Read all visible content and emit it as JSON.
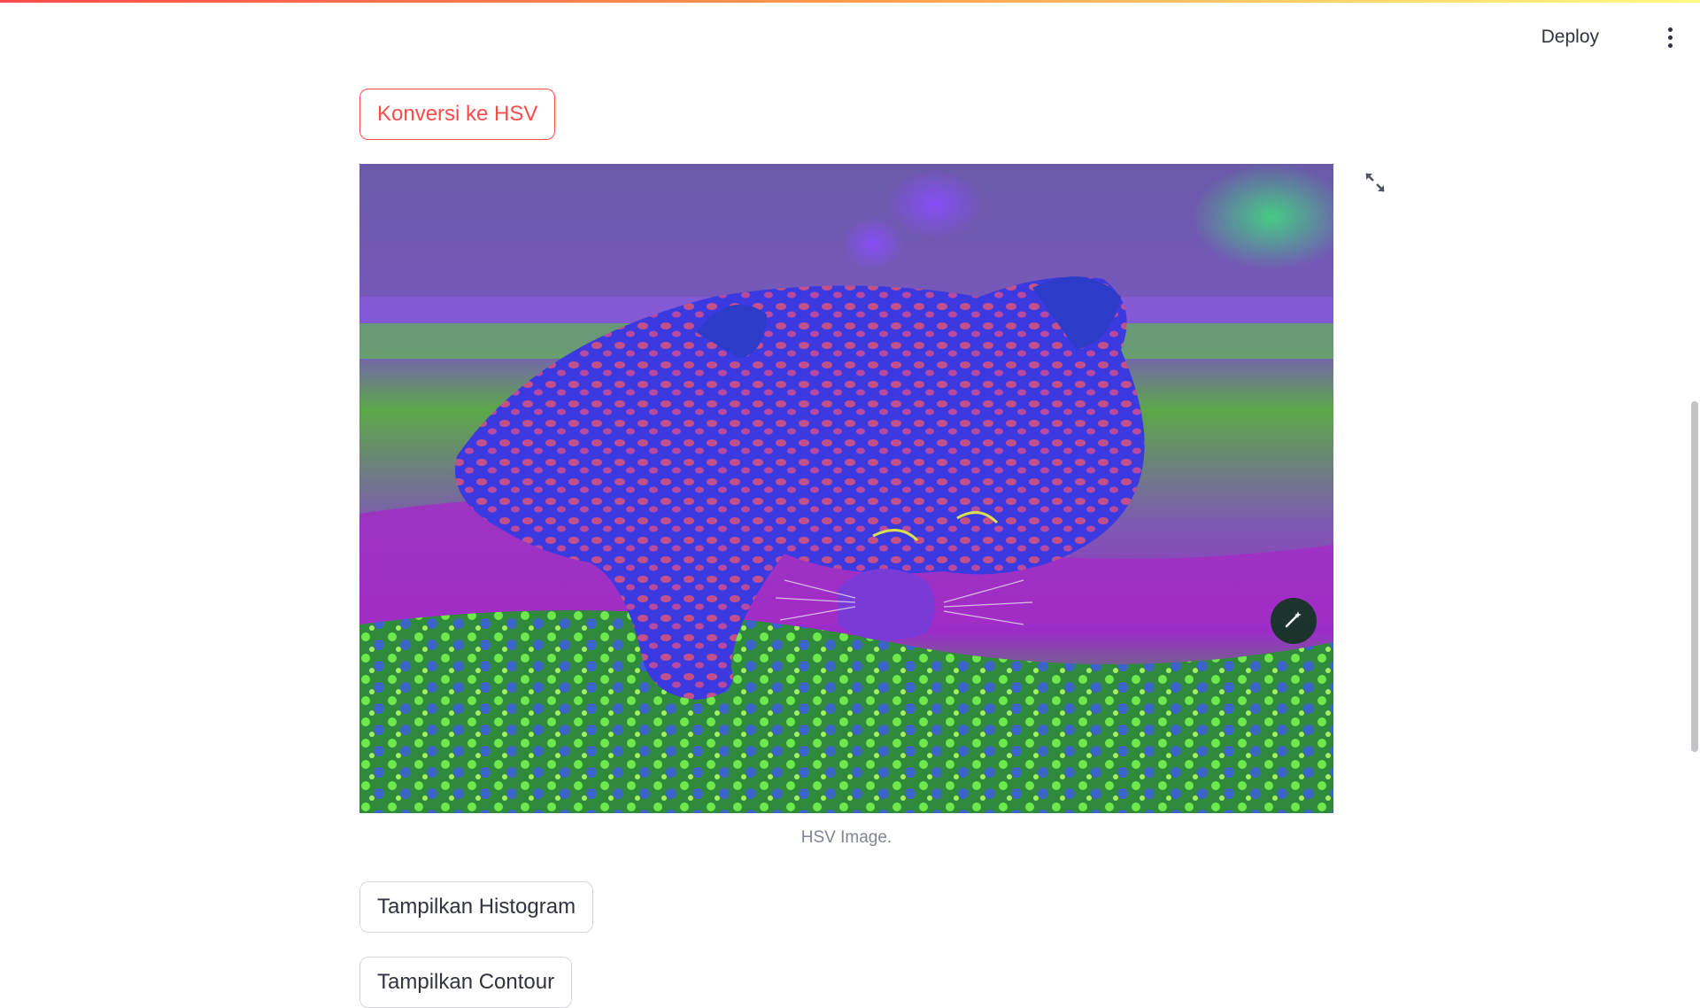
{
  "header": {
    "deploy_label": "Deploy",
    "menu_icon": "vertical-ellipsis-icon"
  },
  "main": {
    "convert_button_label": "Konversi ke HSV",
    "image": {
      "alt": "HSV converted leopard image",
      "caption": "HSV Image.",
      "expand_icon": "fullscreen-expand-icon",
      "edit_icon": "magic-wand-icon"
    },
    "histogram_button_label": "Tampilkan Histogram",
    "contour_button_label": "Tampilkan Contour"
  },
  "colors": {
    "accent": "#ff4b4b",
    "text": "#31333f",
    "caption": "#808495",
    "border": "#d6d6d9"
  }
}
